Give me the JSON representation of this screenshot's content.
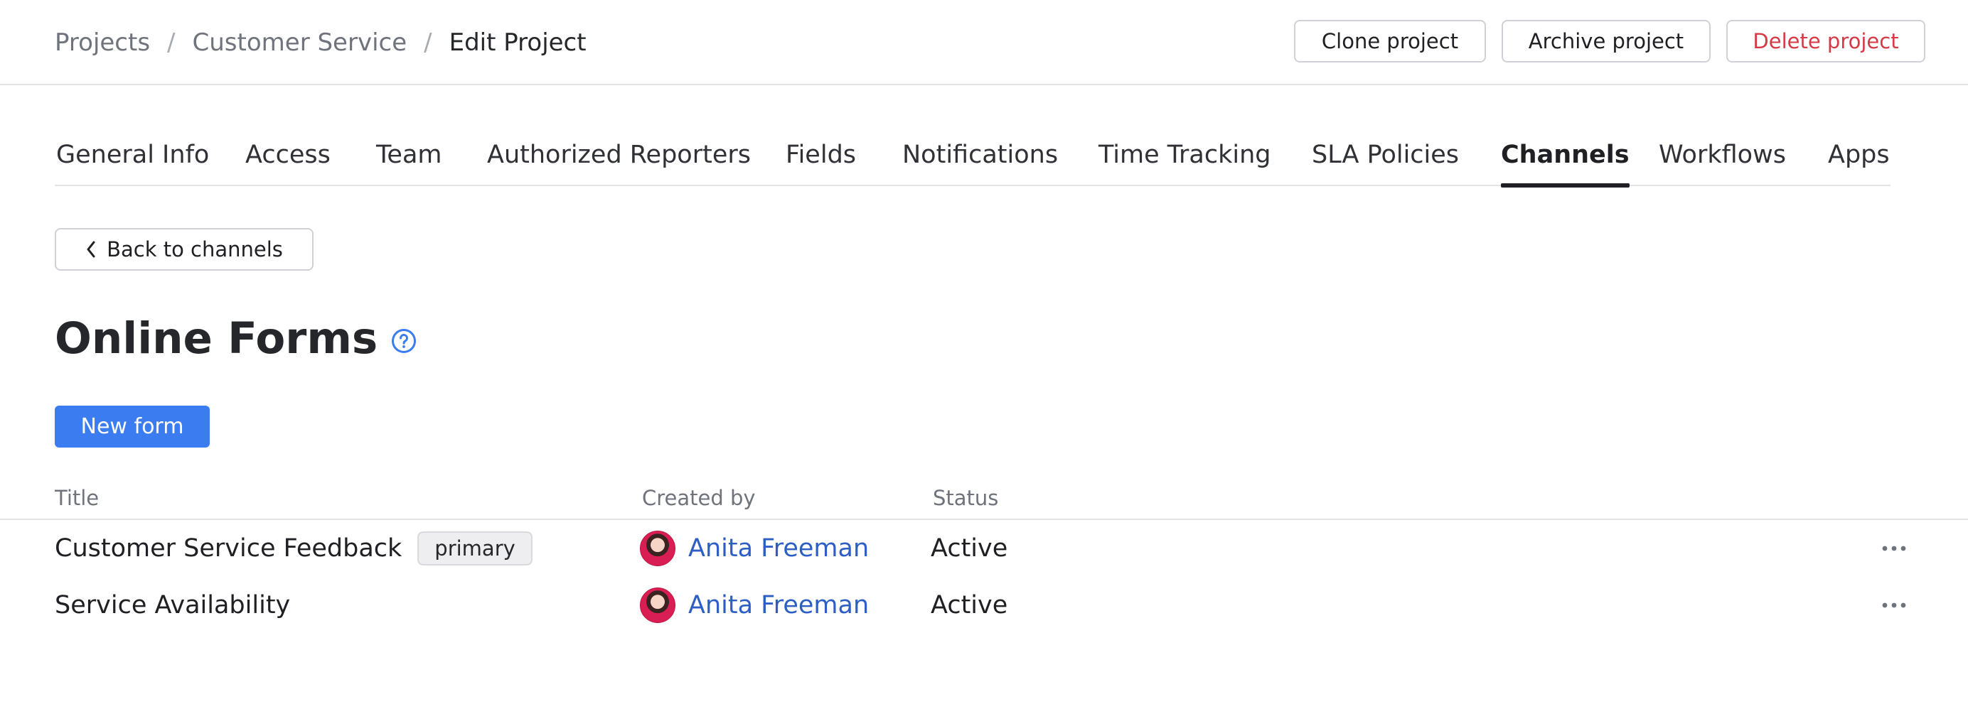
{
  "breadcrumb": {
    "items": [
      "Projects",
      "Customer Service"
    ],
    "separator": "/",
    "current": "Edit Project"
  },
  "header_actions": {
    "clone": "Clone project",
    "archive": "Archive project",
    "delete": "Delete project"
  },
  "tabs": [
    {
      "label": "General Info",
      "active": false
    },
    {
      "label": "Access",
      "active": false
    },
    {
      "label": "Team",
      "active": false
    },
    {
      "label": "Authorized Reporters",
      "active": false
    },
    {
      "label": "Fields",
      "active": false
    },
    {
      "label": "Notifications",
      "active": false
    },
    {
      "label": "Time Tracking",
      "active": false
    },
    {
      "label": "SLA Policies",
      "active": false
    },
    {
      "label": "Channels",
      "active": true
    },
    {
      "label": "Workflows",
      "active": false
    },
    {
      "label": "Apps",
      "active": false
    }
  ],
  "back_button": {
    "label": "Back to channels",
    "icon": "chevron-left-icon"
  },
  "page": {
    "title": "Online Forms",
    "help_icon": "question-circle-icon"
  },
  "new_form_button": {
    "label": "New form"
  },
  "table": {
    "columns": [
      "Title",
      "Created by",
      "Status"
    ],
    "rows": [
      {
        "title": "Customer Service Feedback",
        "badge": "primary",
        "creator": "Anita Freeman",
        "status": "Active"
      },
      {
        "title": "Service Availability",
        "badge": "",
        "creator": "Anita Freeman",
        "status": "Active"
      }
    ]
  },
  "colors": {
    "accent": "#3b7cf0",
    "link": "#2d5ec4",
    "danger": "#d63a45",
    "muted_text": "#6f737c",
    "border": "#cfd1d6"
  }
}
